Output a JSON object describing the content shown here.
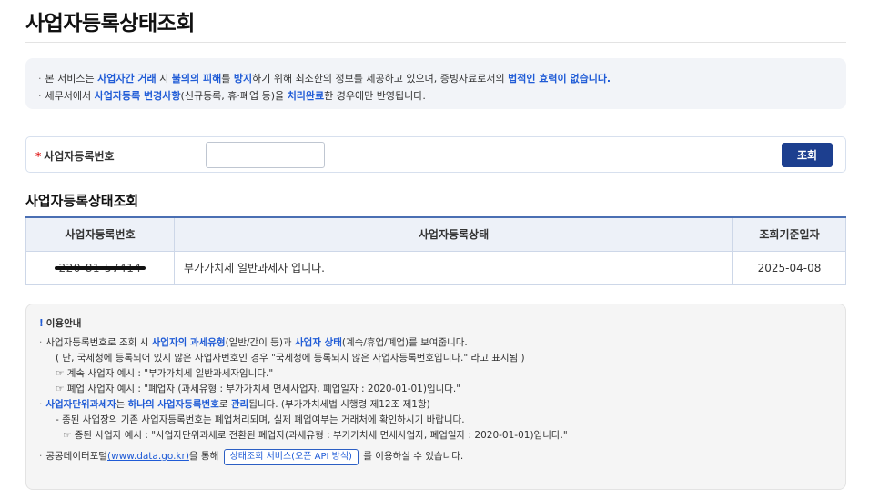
{
  "page": {
    "title": "사업자등록상태조회"
  },
  "notice": {
    "line1": [
      "본 서비스는 ",
      "사업자간 거래",
      " 시 ",
      "불의의 피해",
      "를 ",
      "방지",
      "하기 위해 최소한의 정보를 제공하고 있으며, 증빙자료로서의 ",
      "법적인 효력이 없습니다."
    ],
    "line2": [
      "세무서에서 ",
      "사업자등록 변경사항",
      "(신규등록, 휴·폐업 등)을 ",
      "처리완료",
      "한 경우에만 반영됩니다."
    ]
  },
  "search": {
    "required_mark": "*",
    "label": "사업자등록번호",
    "input_value": "",
    "button": "조회"
  },
  "result": {
    "title": "사업자등록상태조회",
    "headers": [
      "사업자등록번호",
      "사업자등록상태",
      "조회기준일자"
    ],
    "rows": [
      {
        "number": "220-81-57414",
        "status": "부가가치세 일반과세자 입니다.",
        "date": "2025-04-08"
      }
    ]
  },
  "guide": {
    "title": "이용안내",
    "l1": [
      "사업자등록번호로 조회 시 ",
      "사업자의 과세유형",
      "(일반/간이 등)과 ",
      "사업자 상태",
      "(계속/휴업/폐업)를 보여줍니다."
    ],
    "l2": "( 단, 국세청에 등록되어 있지 않은 사업자번호인 경우 \"국세청에 등록되지 않은 사업자등록번호입니다.\" 라고 표시됨 )",
    "l3": "☞ 계속 사업자 예시 : \"부가가치세 일반과세자입니다.\"",
    "l4": "☞ 폐업 사업자 예시 : \"폐업자 (과세유형 : 부가가치세 면세사업자, 폐업일자 : 2020-01-01)입니다.\"",
    "l5": [
      "사업자단위과세자",
      "는 ",
      "하나의 사업자등록번호",
      "로 ",
      "관리",
      "됩니다. (부가가치세법 시행령 제12조 제1항)"
    ],
    "l6": "- 종된 사업장의 기존 사업자등록번호는 폐업처리되며, 실제 폐업여부는 거래처에 확인하시기 바랍니다.",
    "l7": "☞ 종된 사업자 예시 : \"사업자단위과세로 전환된 폐업자(과세유형 : 부가가치세 면세사업자, 폐업일자 : 2020-01-01)입니다.\"",
    "l8": [
      "공공데이터포털",
      "(www.data.go.kr)",
      "을 통해 ",
      "상태조회 서비스(오픈 API 방식)",
      " 를 이용하실 수 있습니다."
    ]
  },
  "colors": {
    "accent": "#1f5bd6",
    "button": "#1d3f8f",
    "required": "#e02020"
  }
}
